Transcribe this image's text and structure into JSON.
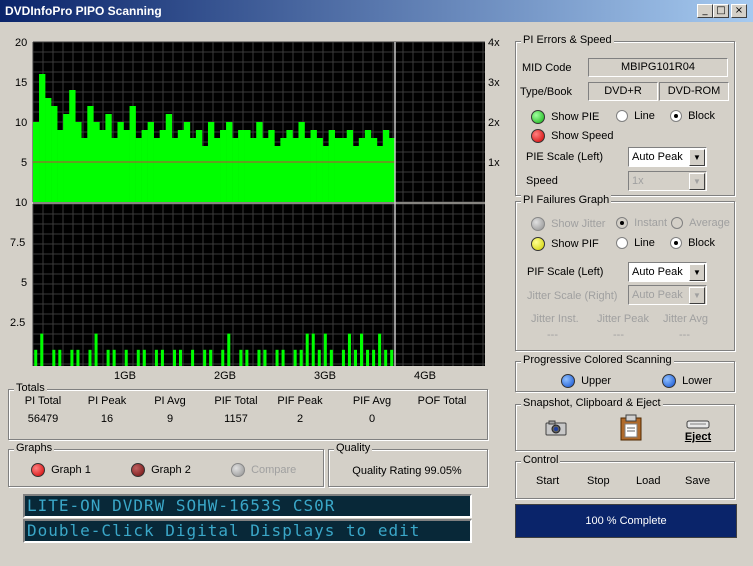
{
  "window": {
    "title": "DVDInfoPro PIPO Scanning",
    "min": "_",
    "max": "□",
    "close": "×"
  },
  "axes": {
    "top_left": [
      "20",
      "15",
      "10",
      "5"
    ],
    "top_right": [
      "4x",
      "3x",
      "2x",
      "1x"
    ],
    "bottom_left": [
      "10",
      "7.5",
      "5",
      "2.5"
    ],
    "x": [
      "1GB",
      "2GB",
      "3GB",
      "4GB"
    ]
  },
  "chart_data": [
    {
      "type": "bar",
      "title": "",
      "ylim": [
        0,
        20
      ],
      "y2_ticks": [
        "1x",
        "2x",
        "3x",
        "4x"
      ],
      "x_ticks": [
        "1GB",
        "2GB",
        "3GB",
        "4GB"
      ],
      "series": [
        {
          "values": [
            10,
            16,
            13,
            12,
            9,
            11,
            14,
            10,
            8,
            12,
            10,
            9,
            11,
            8,
            10,
            9,
            12,
            8,
            9,
            10,
            8,
            9,
            11,
            8,
            9,
            10,
            8,
            9,
            7,
            10,
            8,
            9,
            10,
            8,
            9,
            9,
            8,
            10,
            8,
            9,
            7,
            8,
            9,
            8,
            10,
            8,
            9,
            8,
            7,
            9,
            8,
            8,
            9,
            7,
            8,
            9,
            8,
            7,
            9,
            8
          ],
          "color": "#00ff00"
        },
        {
          "values": [
            5,
            5,
            5,
            5,
            5,
            5,
            5,
            5,
            5,
            5,
            5,
            5,
            5,
            5,
            5,
            5,
            5,
            5,
            5,
            5,
            5,
            5,
            5,
            5,
            5,
            5,
            5,
            5,
            5,
            5,
            5,
            5,
            5,
            5,
            5,
            5,
            5,
            5,
            5,
            5,
            5,
            5,
            5,
            5,
            5,
            5,
            5,
            5,
            5,
            5,
            5,
            5,
            5,
            5,
            5,
            5,
            5,
            5,
            5,
            5
          ],
          "color": "#c04040",
          "style": "line"
        }
      ]
    },
    {
      "type": "bar",
      "title": "",
      "ylim": [
        0,
        10
      ],
      "x_ticks": [
        "1GB",
        "2GB",
        "3GB",
        "4GB"
      ],
      "series": [
        {
          "values": [
            1,
            2,
            0,
            1,
            1,
            0,
            1,
            1,
            0,
            1,
            2,
            0,
            1,
            1,
            0,
            1,
            0,
            1,
            1,
            0,
            1,
            1,
            0,
            1,
            1,
            0,
            1,
            0,
            1,
            1,
            0,
            1,
            2,
            0,
            1,
            1,
            0,
            1,
            1,
            0,
            1,
            1,
            0,
            1,
            1,
            2,
            2,
            1,
            2,
            1,
            0,
            1,
            2,
            1,
            2,
            1,
            1,
            2,
            1,
            1
          ],
          "color": "#00ff00"
        }
      ]
    }
  ],
  "pi_errors": {
    "legend": "PI Errors & Speed",
    "mid_label": "MID Code",
    "mid_value": "MBIPG101R04",
    "type_label": "Type/Book",
    "type_value": "DVD+R",
    "book_value": "DVD-ROM",
    "show_pie": "Show PIE",
    "line": "Line",
    "block": "Block",
    "show_speed": "Show Speed",
    "pie_scale_label": "PIE Scale (Left)",
    "pie_scale_value": "Auto Peak",
    "speed_label": "Speed",
    "speed_value": "1x"
  },
  "pi_failures": {
    "legend": "PI Failures Graph",
    "show_jitter": "Show Jitter",
    "instant": "Instant",
    "average": "Average",
    "show_pif": "Show PIF",
    "line": "Line",
    "block": "Block",
    "pif_scale_label": "PIF Scale (Left)",
    "pif_scale_value": "Auto Peak",
    "jitter_scale_label": "Jitter Scale (Right)",
    "jitter_scale_value": "Auto Peak",
    "jitter_inst": "Jitter Inst.",
    "jitter_peak": "Jitter Peak",
    "jitter_avg": "Jitter Avg",
    "jitter_inst_val": "---",
    "jitter_peak_val": "---",
    "jitter_avg_val": "---"
  },
  "progressive": {
    "legend": "Progressive Colored Scanning",
    "upper": "Upper",
    "lower": "Lower"
  },
  "snapshot": {
    "legend": "Snapshot,  Clipboard  & Eject",
    "eject": "Eject"
  },
  "control": {
    "legend": "Control",
    "start": "Start",
    "stop": "Stop",
    "load": "Load",
    "save": "Save"
  },
  "progress": {
    "text": "100 % Complete",
    "value": 1.0
  },
  "totals": {
    "legend": "Totals",
    "headers": [
      "PI Total",
      "PI Peak",
      "PI Avg",
      "PIF Total",
      "PIF Peak",
      "PIF Avg",
      "POF Total"
    ],
    "values": [
      "56479",
      "16",
      "9",
      "1157",
      "2",
      "0",
      ""
    ]
  },
  "graphs": {
    "legend": "Graphs",
    "graph1": "Graph 1",
    "graph2": "Graph 2",
    "compare": "Compare"
  },
  "quality": {
    "legend": "Quality",
    "rating": "Quality Rating 99.05%"
  },
  "displays": {
    "line1": "LITE-ON DVDRW SOHW-1653S CS0R",
    "line2": "Double-Click Digital Displays to edit"
  }
}
